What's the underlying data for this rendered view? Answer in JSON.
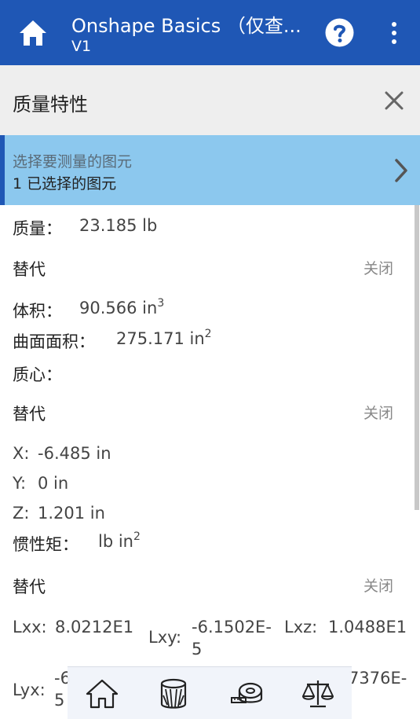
{
  "appbar": {
    "title": "Onshape Basics （仅查...",
    "version": "V1"
  },
  "panel": {
    "title": "质量特性"
  },
  "selection": {
    "prompt": "选择要测量的图元",
    "count": "1 已选择的图元"
  },
  "mass": {
    "label": "质量：",
    "value": "23.185 lb"
  },
  "alt_label": "替代",
  "off_label": "关闭",
  "volume": {
    "label": "体积：",
    "value": "90.566 in",
    "exp": "3"
  },
  "surface_area": {
    "label": "曲面面积：",
    "value": "275.171 in",
    "exp": "2"
  },
  "centroid": {
    "label": "质心：",
    "x_label": "X:",
    "x_value": "-6.485 in",
    "y_label": "Y:",
    "y_value": "0 in",
    "z_label": "Z:",
    "z_value": "1.201 in"
  },
  "inertia": {
    "label": "惯性矩：",
    "unit": "lb in",
    "exp": "2",
    "lxx_label": "Lxx:",
    "lxx_value": "8.0212E1",
    "lxy_label": "Lxy:",
    "lxy_value_1": "-6.1502E-",
    "lxy_value_2": "5",
    "lxz_label": "Lxz:",
    "lxz_value": "1.0488E1",
    "lyx_label": "Lyx:",
    "lyx_value_1": "-6",
    "lyx_value_2": "5",
    "lyz_partial": "7376E-"
  },
  "toolbar": {
    "icons": [
      "home-icon",
      "part-studio-icon",
      "measure-tape-icon",
      "mass-scale-icon"
    ]
  },
  "colors": {
    "appbar": "#1f57b5",
    "selection_bg": "#8cc8ee",
    "panel_header_bg": "#eeeeee"
  }
}
